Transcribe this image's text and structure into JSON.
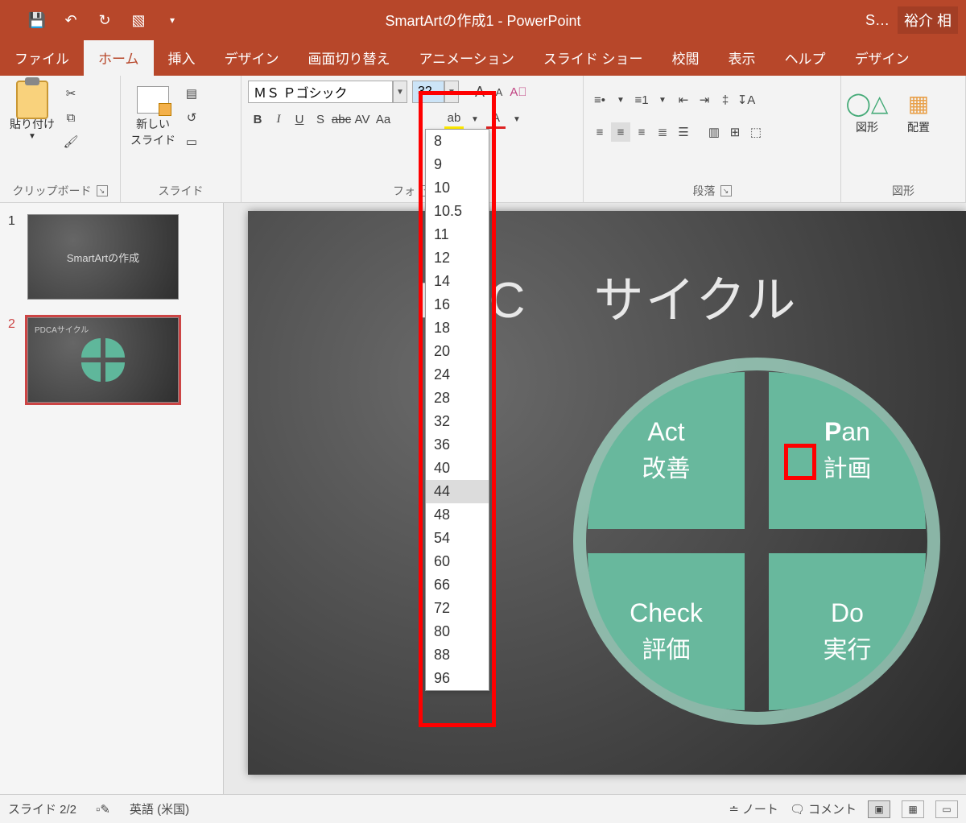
{
  "titlebar": {
    "title": "SmartArtの作成1 - PowerPoint",
    "share_short": "S…",
    "user": "裕介 相"
  },
  "qat": {
    "save": "save-icon",
    "undo": "undo-icon",
    "redo": "redo-icon",
    "start": "slideshow-icon"
  },
  "tabs": {
    "file": "ファイル",
    "home": "ホーム",
    "insert": "挿入",
    "design": "デザイン",
    "transitions": "画面切り替え",
    "animations": "アニメーション",
    "slideshow": "スライド ショー",
    "review": "校閲",
    "view": "表示",
    "help": "ヘルプ",
    "design2": "デザイン"
  },
  "ribbon": {
    "clipboard": {
      "paste": "貼り付け",
      "group": "クリップボード"
    },
    "slides": {
      "new": "新しい\nスライド",
      "group": "スライド"
    },
    "font": {
      "name_value": "ＭＳ Ｐゴシック",
      "size_value": "32",
      "group": "フォ",
      "sizes": [
        "8",
        "9",
        "10",
        "10.5",
        "11",
        "12",
        "14",
        "16",
        "18",
        "20",
        "24",
        "28",
        "32",
        "36",
        "40",
        "44",
        "48",
        "54",
        "60",
        "66",
        "72",
        "80",
        "88",
        "96"
      ],
      "highlight": "44"
    },
    "paragraph": {
      "group": "段落"
    },
    "drawing": {
      "shapes": "図形",
      "arrange": "配置",
      "group": "図形"
    }
  },
  "thumbs": {
    "n1": "1",
    "n2": "2",
    "t1": "SmartArtの作成",
    "t2": "PDCAサイクル"
  },
  "slide": {
    "title": "PDC　 サイクル",
    "act_en": "Act",
    "act_jp": "改善",
    "plan_en_p": "P",
    "plan_en_rest": "an",
    "plan_jp": "計画",
    "check_en": "Check",
    "check_jp": "評価",
    "do_en": "Do",
    "do_jp": "実行"
  },
  "status": {
    "slide": "スライド 2/2",
    "lang": "英語 (米国)",
    "notes": "ノート",
    "comments": "コメント"
  }
}
